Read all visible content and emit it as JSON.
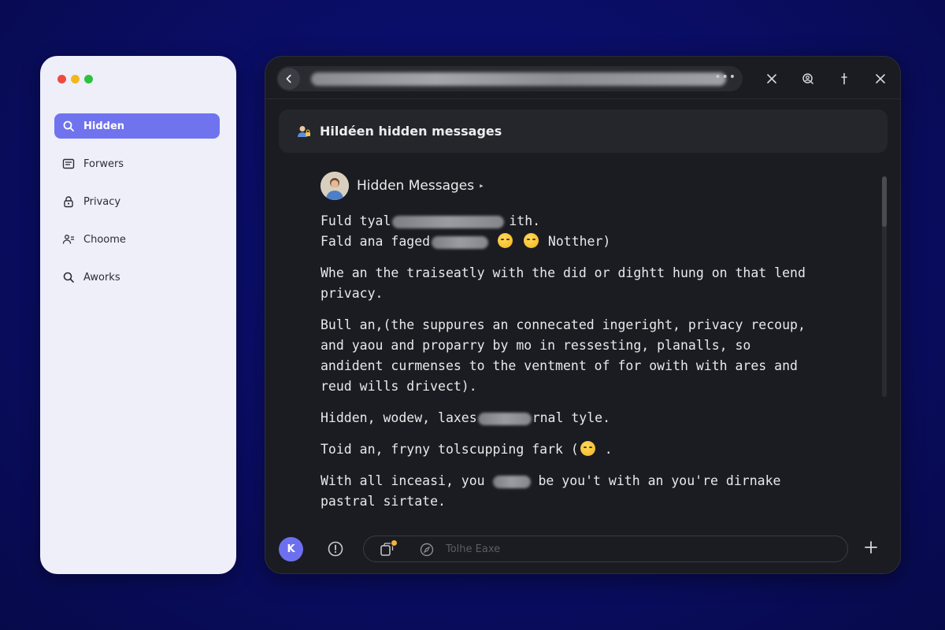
{
  "sidebar": {
    "traffic_lights": [
      "red",
      "yellow",
      "green"
    ],
    "items": [
      {
        "label": "Hidden",
        "icon": "search-icon",
        "active": true
      },
      {
        "label": "Forwers",
        "icon": "list-icon",
        "active": false
      },
      {
        "label": "Privacy",
        "icon": "lock-icon",
        "active": false
      },
      {
        "label": "Choome",
        "icon": "people-icon",
        "active": false
      },
      {
        "label": "Aworks",
        "icon": "search-icon",
        "active": false
      }
    ]
  },
  "titlebar": {
    "url_more": "•••",
    "actions": [
      "close-icon",
      "user-search-icon",
      "pin-icon",
      "close-icon"
    ]
  },
  "banner": {
    "title": "Hildéen hidden messages",
    "icon": "person-lock-icon"
  },
  "message": {
    "sender": "Hidden Messages",
    "caret": "▸",
    "lines": {
      "l1a": "Fuld tyal",
      "l1b": "ith.",
      "l2a": "Fald ana faged",
      "l2b": "Notther)",
      "p2": "Whe an the traiseatly with the did or dightt hung on that lend privacy.",
      "p3": "Bull an,(the suppures an connecated ingeright, privacy recoup, and yaou and proparry by mo in ressesting, planalls, so andident curmenses to the ventment of for owith with ares and reud wills drivect).",
      "p4a": "Hidden, wodew, laxes",
      "p4b": "rnal tyle.",
      "p5a": "Toid an, fryny tolscupping fark (",
      "p5b": ".",
      "p6a": "With all inceasi, you",
      "p6b": "be you't with an you're dirnake pastral sirtate."
    }
  },
  "composer": {
    "badge_label": "K",
    "placeholder": "Tolhe Eaxe"
  },
  "colors": {
    "background": "#0a0d63",
    "accent": "#7073ee",
    "chat_bg": "#1b1c21",
    "sidebar_bg": "#eeeff9"
  }
}
